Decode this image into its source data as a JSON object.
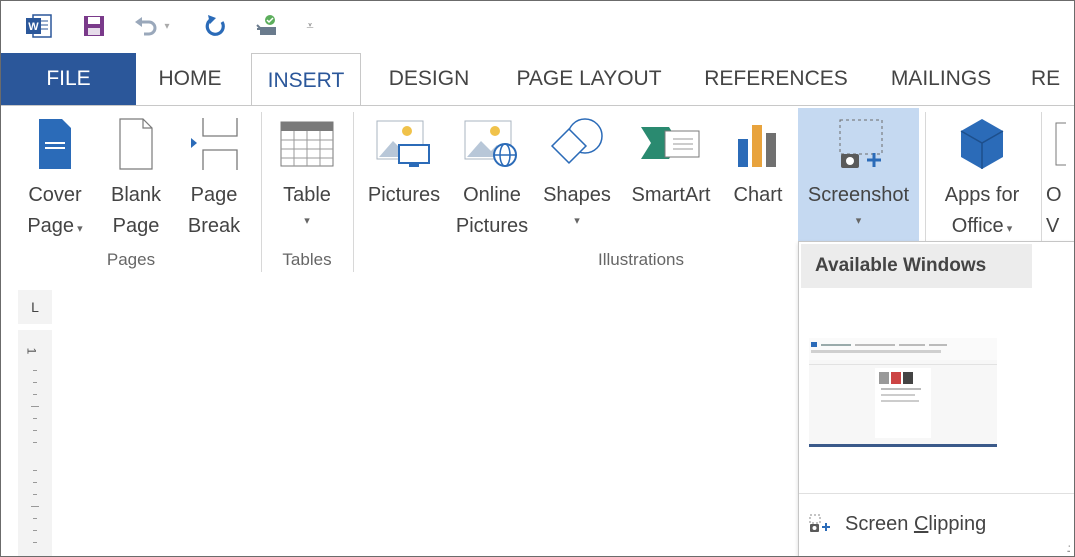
{
  "qat": {
    "icons": [
      "word-app-icon",
      "save-icon",
      "undo-icon",
      "undo-dropdown-icon",
      "redo-icon",
      "touch-mode-icon",
      "customize-qat-icon"
    ]
  },
  "tabs": [
    "FILE",
    "HOME",
    "INSERT",
    "DESIGN",
    "PAGE LAYOUT",
    "REFERENCES",
    "MAILINGS",
    "RE"
  ],
  "active_tab": "INSERT",
  "ribbon": {
    "cover_page": [
      "Cover",
      "Page"
    ],
    "blank_page": [
      "Blank",
      "Page"
    ],
    "page_break": [
      "Page",
      "Break"
    ],
    "table": "Table",
    "pictures": "Pictures",
    "online_pictures": [
      "Online",
      "Pictures"
    ],
    "shapes": "Shapes",
    "smartart": "SmartArt",
    "chart": "Chart",
    "screenshot": "Screenshot",
    "apps_for_office": [
      "Apps for",
      "Office"
    ],
    "cut_off": [
      "O",
      "V"
    ],
    "groups": {
      "pages": "Pages",
      "tables": "Tables",
      "illustrations": "Illustrations"
    }
  },
  "ruler": {
    "corner": "L",
    "marker": "1"
  },
  "dropdown": {
    "header": "Available Windows",
    "screen_clipping_pre": "Screen ",
    "screen_clipping_key": "C",
    "screen_clipping_post": "lipping"
  },
  "colors": {
    "file_tab": "#2b579a",
    "active_tab_text": "#2b579a",
    "highlight": "#c5d9f1",
    "word_blue": "#2b579a"
  }
}
